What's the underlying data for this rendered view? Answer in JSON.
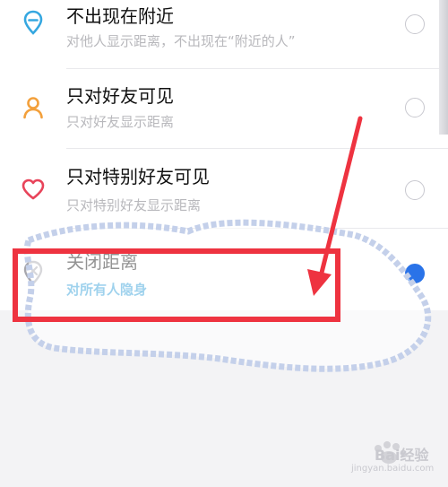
{
  "options": [
    {
      "title": "不出现在附近",
      "subtitle": "对他人显示距离，不出现在“附近的人”",
      "icon": "location-pin-icon",
      "selected": false
    },
    {
      "title": "只对好友可见",
      "subtitle": "只对好友显示距离",
      "icon": "person-icon",
      "selected": false
    },
    {
      "title": "只对特别好友可见",
      "subtitle": "只对特别好友显示距离",
      "icon": "heart-icon",
      "selected": false
    },
    {
      "title": "关闭距离",
      "subtitle": "对所有人隐身",
      "icon": "location-off-icon",
      "selected": true
    }
  ],
  "colors": {
    "accent_blue": "#2a9bd8",
    "radio_selected": "#2a73e8",
    "annotation_red": "#ee3340",
    "pin_blue": "#35a7e0",
    "person_orange": "#f3a03b",
    "heart_red": "#e8445a"
  },
  "watermark": {
    "text": "Bai经验",
    "sub": "jingyan.baidu.com"
  }
}
